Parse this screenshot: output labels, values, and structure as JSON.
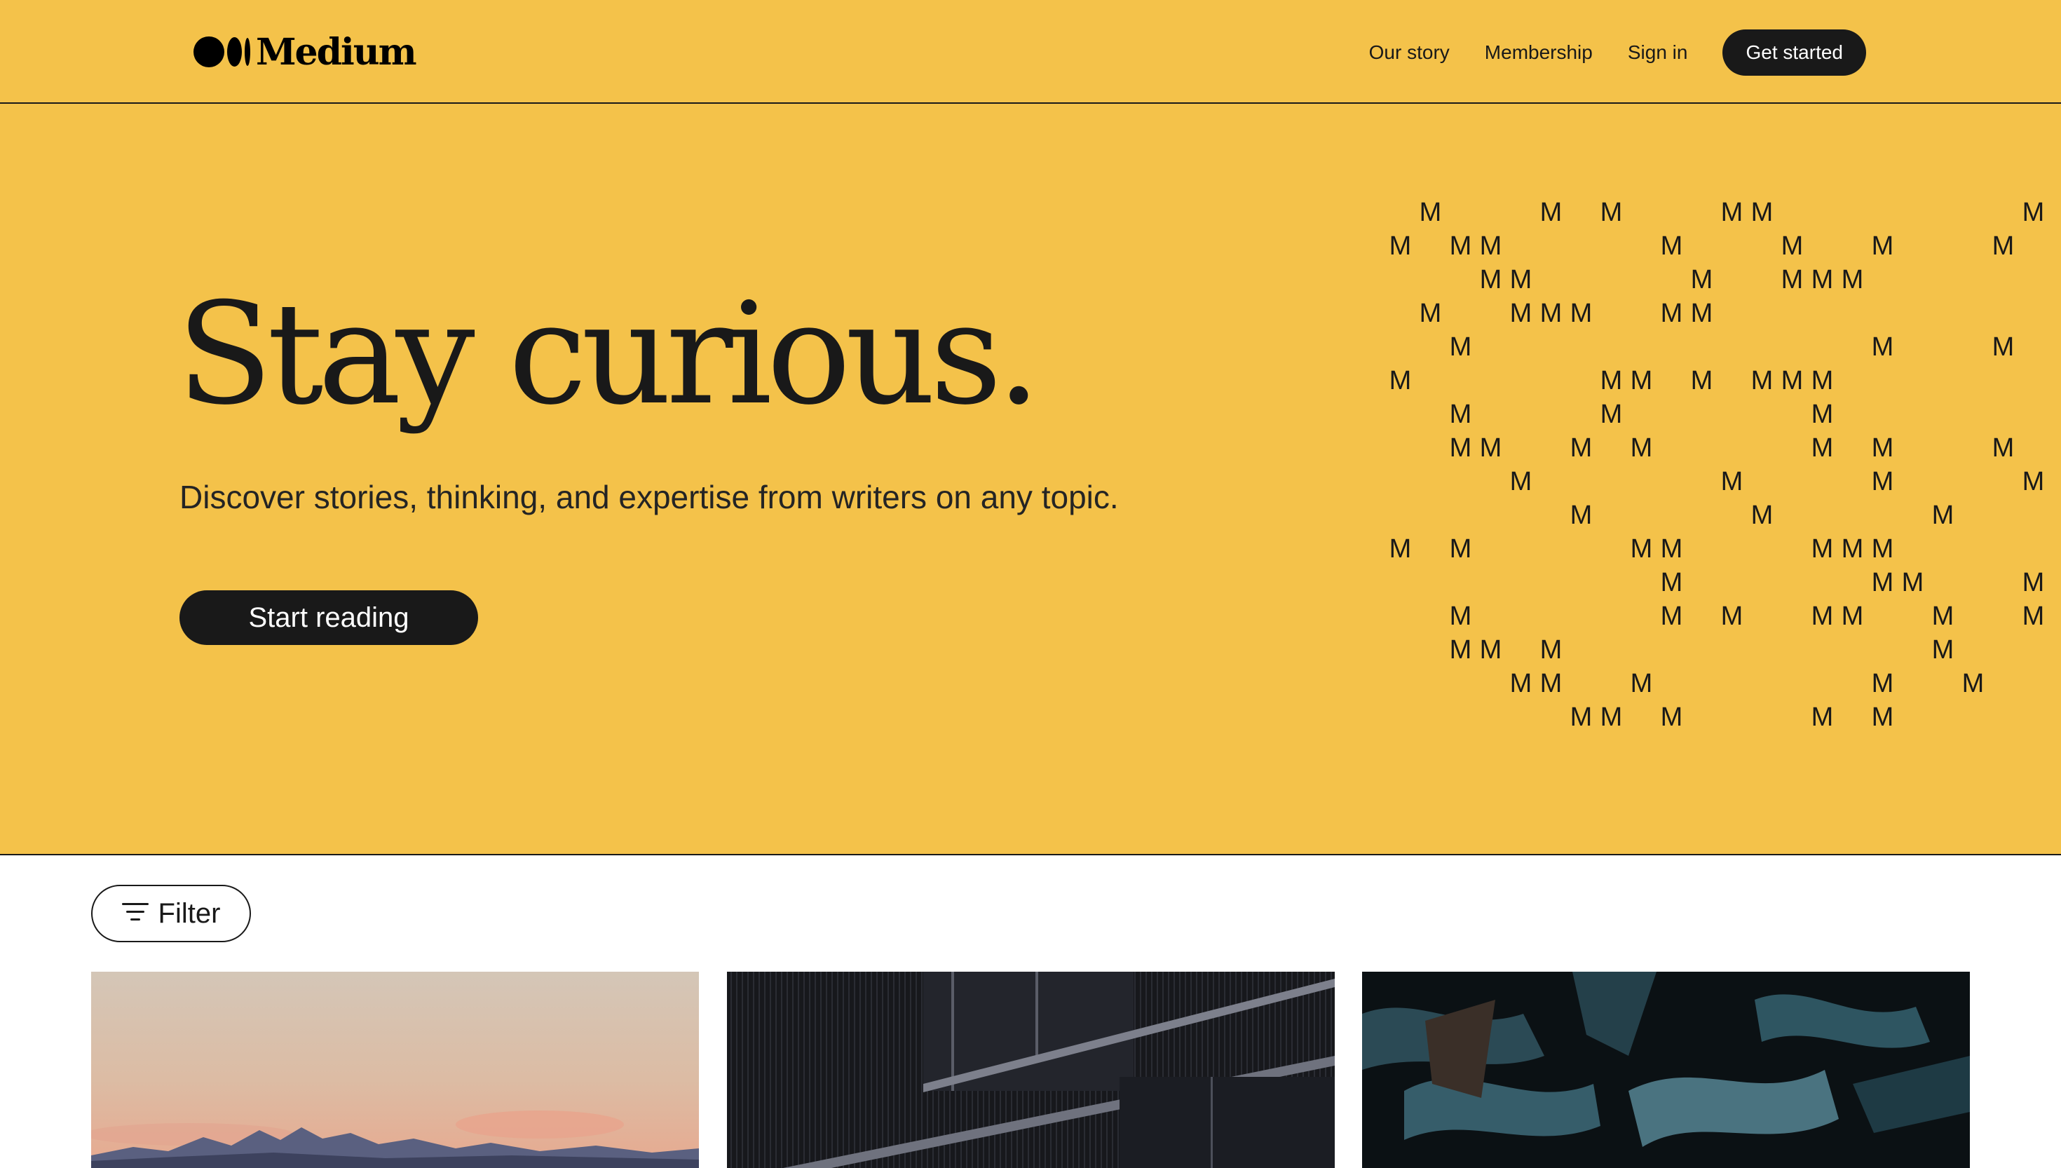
{
  "header": {
    "logo_text": "Medium",
    "nav": [
      {
        "label": "Our story"
      },
      {
        "label": "Membership"
      },
      {
        "label": "Sign in"
      }
    ],
    "get_started_label": "Get started"
  },
  "hero": {
    "title": "Stay curious.",
    "subtitle": "Discover stories, thinking, and expertise from writers on any topic.",
    "cta_label": "Start reading",
    "pattern_glyph": "M",
    "pattern_rows": [
      [
        1,
        5,
        7,
        11,
        12,
        21
      ],
      [
        0,
        2,
        3,
        9,
        13,
        16,
        20
      ],
      [
        3,
        4,
        10,
        13,
        14,
        15
      ],
      [
        1,
        4,
        5,
        6,
        9,
        10
      ],
      [
        2,
        16,
        20
      ],
      [
        0,
        7,
        8,
        10,
        12,
        13,
        14
      ],
      [
        2,
        7,
        14
      ],
      [
        2,
        3,
        6,
        8,
        14,
        16,
        20
      ],
      [
        4,
        11,
        16,
        21
      ],
      [
        6,
        12,
        18
      ],
      [
        0,
        2,
        8,
        9,
        14,
        15,
        16
      ],
      [
        9,
        16,
        17,
        21
      ],
      [
        2,
        9,
        11,
        14,
        15,
        18,
        21
      ],
      [
        2,
        3,
        5,
        18
      ],
      [
        4,
        5,
        8,
        16,
        19
      ],
      [
        6,
        7,
        9,
        14,
        16
      ]
    ]
  },
  "feed": {
    "filter_label": "Filter",
    "cards": [
      {
        "image": "mountain-sunset-image"
      },
      {
        "image": "building-facade-image"
      },
      {
        "image": "abstract-shapes-image"
      }
    ]
  },
  "colors": {
    "accent": "#f4c24a",
    "ink": "#191919",
    "background": "#ffffff"
  }
}
